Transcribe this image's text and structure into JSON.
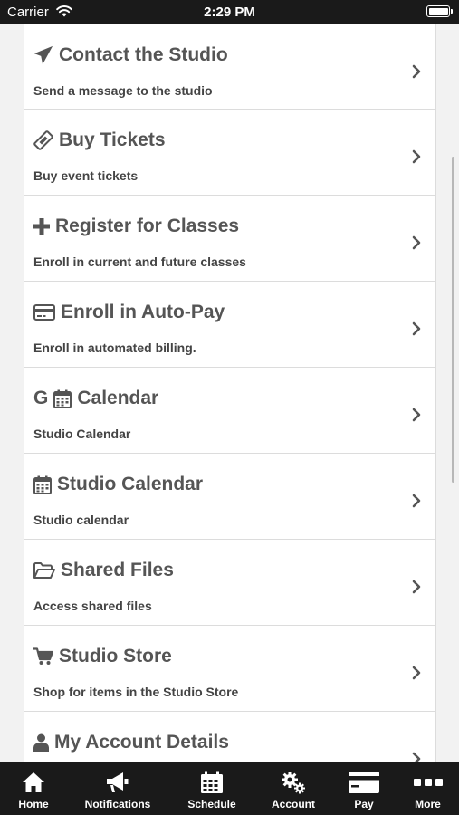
{
  "status_bar": {
    "carrier": "Carrier",
    "time": "2:29 PM"
  },
  "menu": {
    "items": [
      {
        "title": "Contact the Studio",
        "subtitle": "Send a message to the studio",
        "icon": "paper-plane-icon"
      },
      {
        "title": "Buy Tickets",
        "subtitle": "Buy event tickets",
        "icon": "ticket-icon"
      },
      {
        "title": "Register for Classes",
        "subtitle": "Enroll in current and future classes",
        "icon": "plus-icon"
      },
      {
        "title": "Enroll in Auto-Pay",
        "subtitle": "Enroll in automated billing.",
        "icon": "credit-card-icon"
      },
      {
        "title": "Calendar",
        "subtitle": "Studio Calendar",
        "icon": "calendar-icon",
        "prefix": "G"
      },
      {
        "title": "Studio Calendar",
        "subtitle": "Studio calendar",
        "icon": "calendar-icon"
      },
      {
        "title": "Shared Files",
        "subtitle": "Access shared files",
        "icon": "folder-open-icon"
      },
      {
        "title": "Studio Store",
        "subtitle": "Shop for items in the Studio Store",
        "icon": "shopping-cart-icon"
      },
      {
        "title": "My Account Details",
        "subtitle": "",
        "icon": "user-icon"
      }
    ]
  },
  "tab_bar": {
    "tabs": [
      {
        "label": "Home",
        "icon": "home-icon"
      },
      {
        "label": "Notifications",
        "icon": "megaphone-icon"
      },
      {
        "label": "Schedule",
        "icon": "calendar-grid-icon"
      },
      {
        "label": "Account",
        "icon": "gears-icon"
      },
      {
        "label": "Pay",
        "icon": "credit-card-icon"
      },
      {
        "label": "More",
        "icon": "ellipsis-icon"
      }
    ]
  },
  "colors": {
    "bars": "#1a1a1a",
    "card_background": "#ffffff",
    "page_background": "#f2f2f2",
    "title_text": "#555555"
  }
}
